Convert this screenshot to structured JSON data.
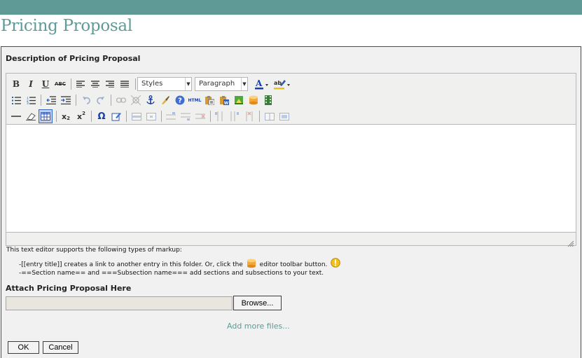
{
  "page": {
    "title": "Pricing Proposal"
  },
  "form": {
    "description_label": "Description of Pricing Proposal",
    "attach_label": "Attach Pricing Proposal Here",
    "browse_label": "Browse...",
    "add_more_label": "Add more files...",
    "ok_label": "OK",
    "cancel_label": "Cancel",
    "file_value": ""
  },
  "toolbar": {
    "styles_value": "Styles",
    "paragraph_value": "Paragraph",
    "row1": [
      "bold-icon",
      "italic-icon",
      "underline-icon",
      "strikethrough-icon",
      "align-left-icon",
      "align-center-icon",
      "align-right-icon",
      "align-justify-icon",
      "styles-select",
      "format-select",
      "text-color-icon",
      "highlight-icon"
    ],
    "row2": [
      "bullet-list-icon",
      "numbered-list-icon",
      "outdent-icon",
      "indent-icon",
      "undo-icon",
      "redo-icon",
      "link-icon",
      "unlink-icon",
      "anchor-icon",
      "cleanup-icon",
      "help-icon",
      "html-icon",
      "paste-text-icon",
      "paste-word-icon",
      "insert-image-icon",
      "wiki-link-icon",
      "media-icon"
    ],
    "row3": [
      "horizontal-rule-icon",
      "remove-format-icon",
      "table-icon",
      "subscript-icon",
      "superscript-icon",
      "special-char-icon",
      "edit-icon",
      "row-props-icon",
      "cell-props-icon",
      "insert-row-before-icon",
      "insert-row-after-icon",
      "delete-row-icon",
      "insert-col-before-icon",
      "insert-col-after-icon",
      "delete-col-icon",
      "split-cells-icon",
      "merge-cells-icon"
    ]
  },
  "help": {
    "line1": "This text editor supports the following types of markup:",
    "line2a": "-[[entry title]] creates a link to another entry in this folder. Or, click the",
    "line2b": "editor toolbar button.",
    "line3": "-==Section name== and ===Subsection name=== add sections and subsections to your text."
  },
  "colors": {
    "accent": "#5f9a97",
    "panel": "#f1f1f1",
    "link": "#5f9a97"
  }
}
